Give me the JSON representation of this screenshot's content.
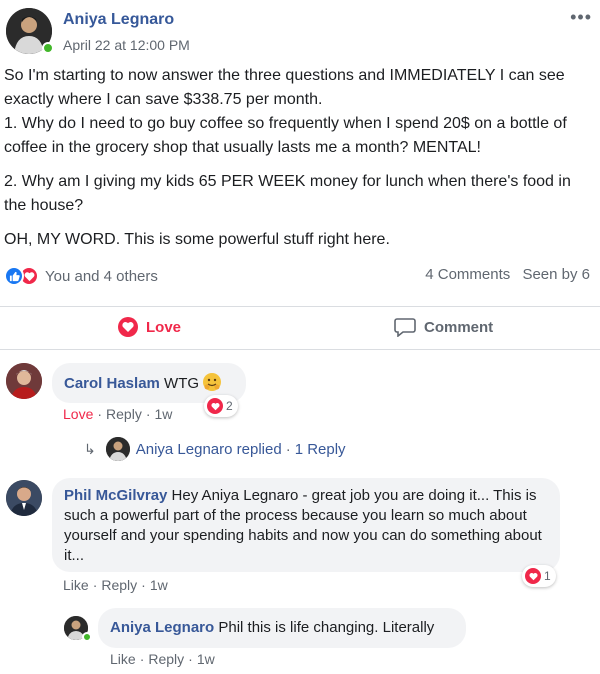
{
  "post": {
    "author": "Aniya Legnaro",
    "timestamp": "April 22 at 12:00 PM",
    "more_icon": "•••",
    "body": {
      "line1": "So I'm starting to now answer the three questions and IMMEDIATELY I can see exactly where I can save $338.75 per month.",
      "line2": "1. Why do I need to go buy coffee so frequently when I spend 20$ on a bottle of coffee in the grocery shop that usually lasts me a month? MENTAL!",
      "line3": "2. Why am I giving my kids 65 PER WEEK money for lunch when there's food in the house?",
      "line4": "OH, MY WORD. This is some powerful stuff right here."
    },
    "reactions_text": "You and 4 others",
    "comments_count": "4 Comments",
    "seen_by": "Seen by 6",
    "actions": {
      "love": "Love",
      "comment": "Comment"
    }
  },
  "comments": [
    {
      "author": "Carol Haslam",
      "text": "WTG",
      "meta": {
        "love": "Love",
        "reply": "Reply",
        "time": "1w"
      },
      "reaction_count": "2",
      "replied": {
        "author": "Aniya Legnaro",
        "verb": "replied",
        "link": "1 Reply"
      }
    },
    {
      "author": "Phil McGilvray",
      "text": "Hey Aniya Legnaro - great job you are doing it... This is such a powerful part of the process because you learn so much about yourself and your spending habits and now you can do something about it...",
      "meta": {
        "like": "Like",
        "reply": "Reply",
        "time": "1w"
      },
      "reaction_count": "1"
    },
    {
      "author": "Aniya Legnaro",
      "text": "Phil this is life changing. Literally",
      "meta": {
        "like": "Like",
        "reply": "Reply",
        "time": "1w"
      }
    }
  ],
  "colors": {
    "name_blue": "#385898",
    "love_red": "#f0284a",
    "like_blue": "#1877f2",
    "online_green": "#42b72a",
    "bubble_gray": "#f2f3f5",
    "meta_gray": "#606770"
  }
}
